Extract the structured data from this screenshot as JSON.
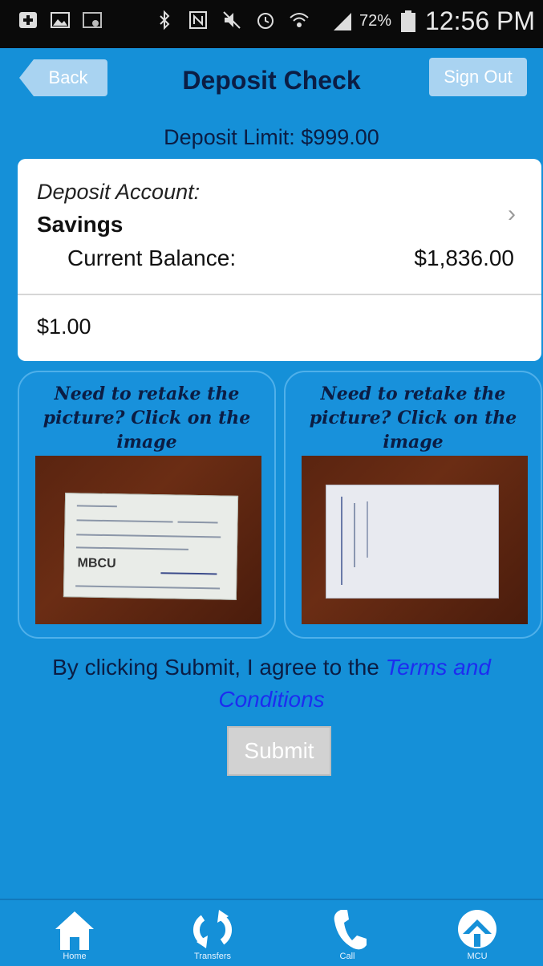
{
  "status_bar": {
    "battery": "72%",
    "time": "12:56 PM"
  },
  "header": {
    "back_label": "Back",
    "title": "Deposit Check",
    "signout_label": "Sign Out"
  },
  "deposit_limit": "Deposit Limit: $999.00",
  "account": {
    "label": "Deposit Account:",
    "name": "Savings",
    "balance_label": "Current Balance:",
    "balance_value": "$1,836.00",
    "amount": "$1.00"
  },
  "images": {
    "front_prompt": "Need to retake the picture? Click on the image",
    "back_prompt": "Need to retake the picture? Click on the image",
    "front_logo_text": "MBCU"
  },
  "terms": {
    "prefix": "By clicking Submit, I agree to the ",
    "link": "Terms and Conditions"
  },
  "submit_label": "Submit",
  "tabs": [
    {
      "label": "Home",
      "icon": "home-icon"
    },
    {
      "label": "Transfers",
      "icon": "refresh-icon"
    },
    {
      "label": "Call",
      "icon": "phone-icon"
    },
    {
      "label": "MCU",
      "icon": "logo-icon"
    }
  ],
  "colors": {
    "background": "#1590d8",
    "title_text": "#0b1d44",
    "link": "#1d2df0",
    "button_light": "#a9d3f1",
    "submit_disabled": "#d2d2d2"
  }
}
